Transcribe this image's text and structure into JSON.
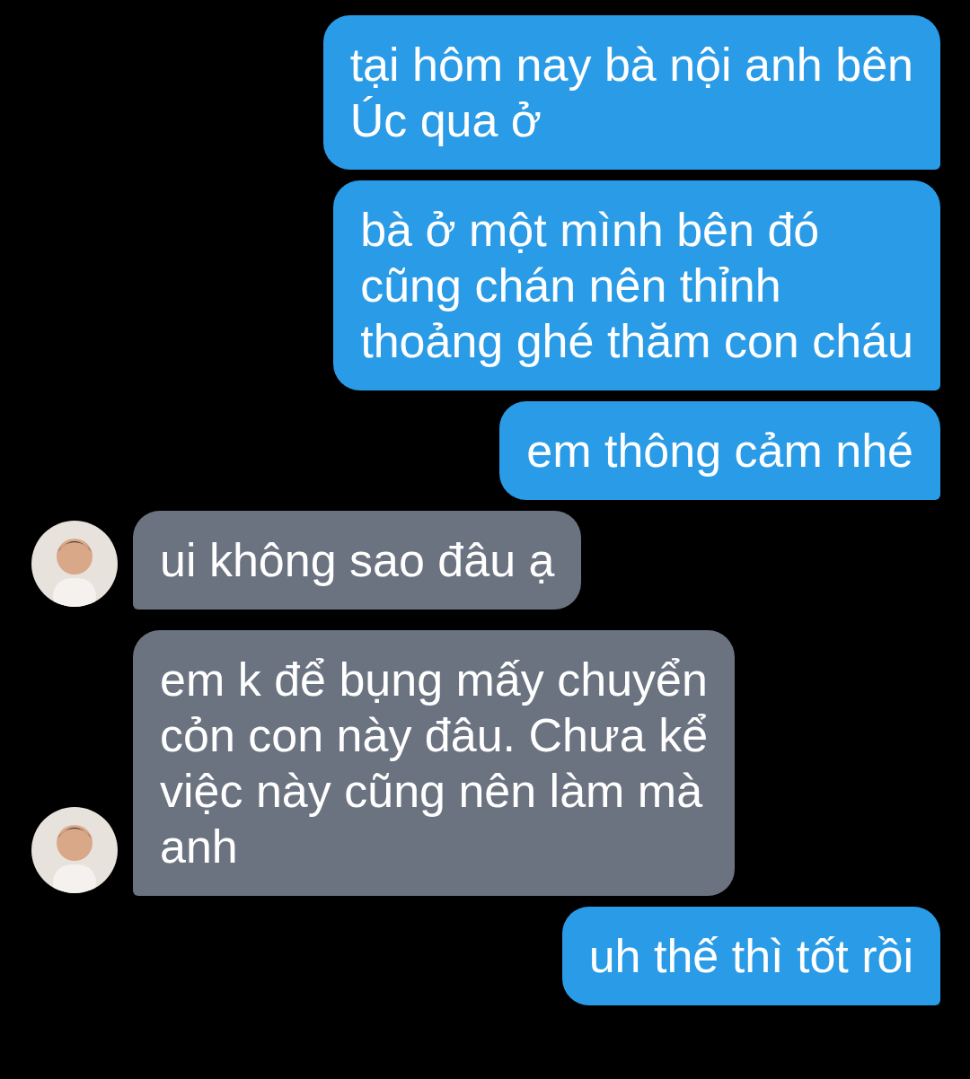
{
  "messages": [
    {
      "kind": "outgoing",
      "text": "tại hôm nay bà nội anh bên\nÚc qua ở"
    },
    {
      "kind": "outgoing",
      "text": "bà ở một mình bên đó\ncũng chán nên thỉnh\nthoảng ghé thăm con cháu"
    },
    {
      "kind": "outgoing",
      "text": "em thông cảm nhé"
    },
    {
      "kind": "incoming",
      "text": "ui không sao đâu ạ"
    },
    {
      "kind": "incoming",
      "text": "em k để bụng mấy chuyển\ncỏn con này đâu. Chưa kể\nviệc này cũng nên làm mà\nanh"
    },
    {
      "kind": "outgoing",
      "text": "uh thế thì tốt rồi"
    }
  ]
}
